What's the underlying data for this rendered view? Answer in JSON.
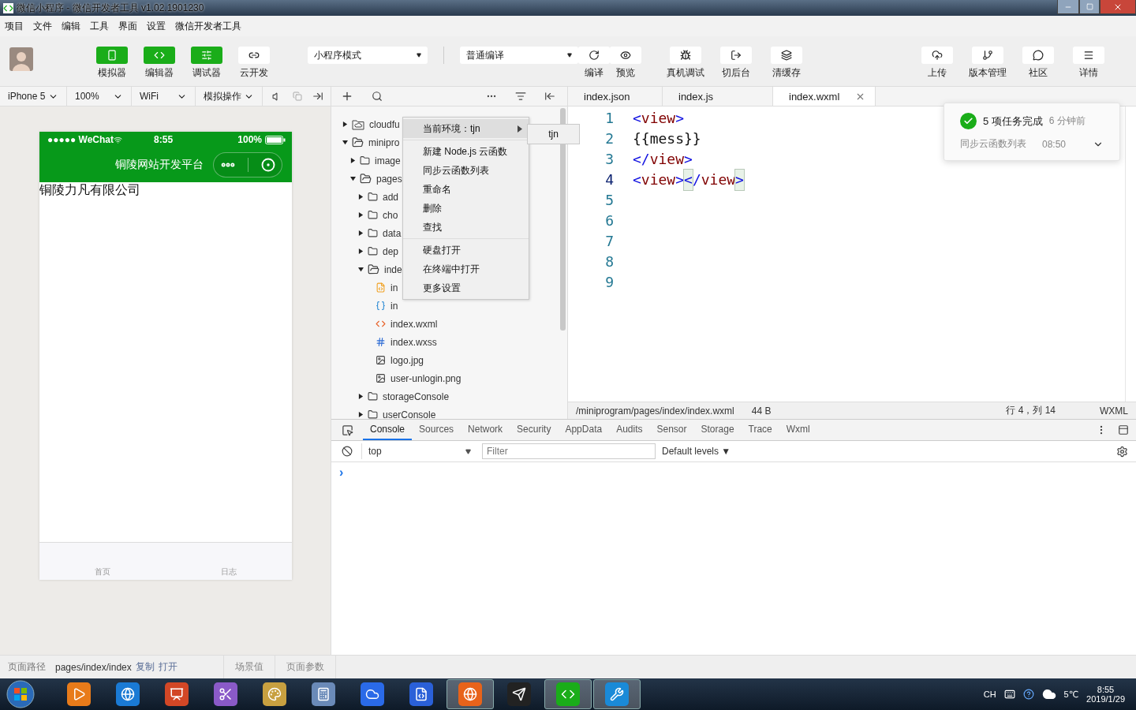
{
  "window": {
    "title": "微信小程序 - 微信开发者工具 v1.02.1901230"
  },
  "menu": [
    "项目",
    "文件",
    "编辑",
    "工具",
    "界面",
    "设置",
    "微信开发者工具"
  ],
  "toolbar": {
    "view_toggles": [
      {
        "kind": "simulator",
        "label": "模拟器",
        "on": true
      },
      {
        "kind": "editor",
        "label": "编辑器",
        "on": true
      },
      {
        "kind": "debugger",
        "label": "调试器",
        "on": true
      },
      {
        "kind": "cloud",
        "label": "云开发",
        "on": false
      }
    ],
    "mode_select": {
      "value": "小程序模式"
    },
    "compile_select": {
      "value": "普通编译"
    },
    "actions": [
      {
        "kind": "compile",
        "label": "编译"
      },
      {
        "kind": "preview",
        "label": "预览"
      },
      {
        "kind": "remote-debug",
        "label": "真机调试"
      },
      {
        "kind": "background",
        "label": "切后台"
      },
      {
        "kind": "clear-cache",
        "label": "清缓存"
      }
    ],
    "right_actions": [
      {
        "kind": "upload",
        "label": "上传"
      },
      {
        "kind": "version",
        "label": "版本管理"
      },
      {
        "kind": "community",
        "label": "社区"
      },
      {
        "kind": "details",
        "label": "详情"
      }
    ]
  },
  "simulator_bar": {
    "device": "iPhone 5",
    "zoom": "100%",
    "network": "WiFi",
    "operate": "模拟操作"
  },
  "editor_tabs": [
    {
      "label": "index.json",
      "selected": false
    },
    {
      "label": "index.js",
      "selected": false
    },
    {
      "label": "index.wxml",
      "selected": true
    }
  ],
  "phone": {
    "carrier": "●●●●● WeChat",
    "time": "8:55",
    "battery": "100%",
    "nav_title": "铜陵网站开发平台",
    "content": "铜陵力凡有限公司",
    "tab_bar": [
      "首页",
      "日志"
    ]
  },
  "file_tree": [
    {
      "name": "cloudfu",
      "kind": "cloud-folder",
      "expanded": false
    },
    {
      "name": "minipro",
      "kind": "folder",
      "expanded": true,
      "children": [
        {
          "name": "image",
          "kind": "folder",
          "expanded": false
        },
        {
          "name": "pages",
          "kind": "folder",
          "expanded": true,
          "children": [
            {
              "name": "add",
              "kind": "folder",
              "expanded": false
            },
            {
              "name": "cho",
              "kind": "folder",
              "expanded": false
            },
            {
              "name": "data",
              "kind": "folder",
              "expanded": false
            },
            {
              "name": "dep",
              "kind": "folder",
              "expanded": false
            },
            {
              "name": "inde",
              "kind": "folder",
              "expanded": true,
              "children": [
                {
                  "name": "in",
                  "kind": "js"
                },
                {
                  "name": "in",
                  "kind": "json"
                },
                {
                  "name": "index.wxml",
                  "kind": "wxml"
                },
                {
                  "name": "index.wxss",
                  "kind": "wxss"
                },
                {
                  "name": "logo.jpg",
                  "kind": "image"
                },
                {
                  "name": "user-unlogin.png",
                  "kind": "image"
                }
              ]
            },
            {
              "name": "storageConsole",
              "kind": "folder",
              "expanded": false
            },
            {
              "name": "userConsole",
              "kind": "folder",
              "expanded": false
            }
          ]
        }
      ]
    }
  ],
  "context_menu": {
    "groups": [
      [
        {
          "label": "当前环境：tjn",
          "selected": true,
          "submenu": true
        }
      ],
      [
        {
          "label": "新建 Node.js 云函数",
          "selected": false,
          "submenu": false
        },
        {
          "label": "同步云函数列表",
          "selected": false,
          "submenu": false
        },
        {
          "label": "重命名",
          "selected": false,
          "submenu": false
        },
        {
          "label": "删除",
          "selected": false,
          "submenu": false
        },
        {
          "label": "查找",
          "selected": false,
          "submenu": false
        }
      ],
      [
        {
          "label": "硬盘打开",
          "selected": false,
          "submenu": false
        },
        {
          "label": "在终端中打开",
          "selected": false,
          "submenu": false
        },
        {
          "label": "更多设置",
          "selected": false,
          "submenu": false
        }
      ]
    ],
    "submenu": [
      "tjn"
    ]
  },
  "code": [
    {
      "number": "1",
      "tokens": [
        {
          "kind": "bracket",
          "text": "<"
        },
        {
          "kind": "tag",
          "text": "view"
        },
        {
          "kind": "bracket",
          "text": ">"
        }
      ]
    },
    {
      "number": "2",
      "tokens": [
        {
          "kind": "text",
          "text": "{{mess}}"
        }
      ]
    },
    {
      "number": "3",
      "tokens": [
        {
          "kind": "bracket",
          "text": "</"
        },
        {
          "kind": "tag",
          "text": "view"
        },
        {
          "kind": "bracket",
          "text": ">"
        }
      ]
    },
    {
      "number": "4",
      "current": true,
      "tokens": [
        {
          "kind": "bracket",
          "text": "<"
        },
        {
          "kind": "tag",
          "text": "view"
        },
        {
          "kind": "bracket",
          "text": ">"
        },
        {
          "kind": "bracket-match",
          "text": "<"
        },
        {
          "kind": "bracket",
          "text": "/"
        },
        {
          "kind": "tag",
          "text": "view"
        },
        {
          "kind": "bracket-match",
          "text": ">"
        }
      ]
    },
    {
      "number": "5"
    },
    {
      "number": "6"
    },
    {
      "number": "7"
    },
    {
      "number": "8"
    },
    {
      "number": "9"
    }
  ],
  "editor_status": {
    "path": "/miniprogram/pages/index/index.wxml",
    "size": "44 B",
    "position": "行 4，列 14",
    "language": "WXML"
  },
  "notification": {
    "title": "5 项任务完成",
    "age": "6 分钟前",
    "task": "同步云函数列表",
    "time": "08:50"
  },
  "devtools": {
    "tabs": [
      {
        "label": "Console",
        "selected": true
      },
      {
        "label": "Sources",
        "selected": false
      },
      {
        "label": "Network",
        "selected": false
      },
      {
        "label": "Security",
        "selected": false
      },
      {
        "label": "AppData",
        "selected": false
      },
      {
        "label": "Audits",
        "selected": false
      },
      {
        "label": "Sensor",
        "selected": false
      },
      {
        "label": "Storage",
        "selected": false
      },
      {
        "label": "Trace",
        "selected": false
      },
      {
        "label": "Wxml",
        "selected": false
      }
    ],
    "context": "top",
    "filter_placeholder": "Filter",
    "levels": "Default levels ▼",
    "prompt": "›"
  },
  "page_status": {
    "label": "页面路径",
    "path": "pages/index/index",
    "links": [
      "复制",
      "打开"
    ],
    "sections": [
      "场景值",
      "页面参数"
    ]
  },
  "taskbar": {
    "apps": [
      {
        "kind": "media",
        "open": false
      },
      {
        "kind": "browser",
        "open": false
      },
      {
        "kind": "slides",
        "open": false
      },
      {
        "kind": "scissors",
        "open": false
      },
      {
        "kind": "paint",
        "open": false
      },
      {
        "kind": "calculator",
        "open": false
      },
      {
        "kind": "cloud-drive",
        "open": false
      },
      {
        "kind": "office",
        "open": false
      },
      {
        "kind": "firefox",
        "open": true
      },
      {
        "kind": "penguin",
        "open": false
      },
      {
        "kind": "devtool",
        "open": true
      },
      {
        "kind": "tool",
        "open": true
      }
    ],
    "language": "CH",
    "temperature": "5℃",
    "time": "8:55",
    "date": "2019/1/29"
  }
}
